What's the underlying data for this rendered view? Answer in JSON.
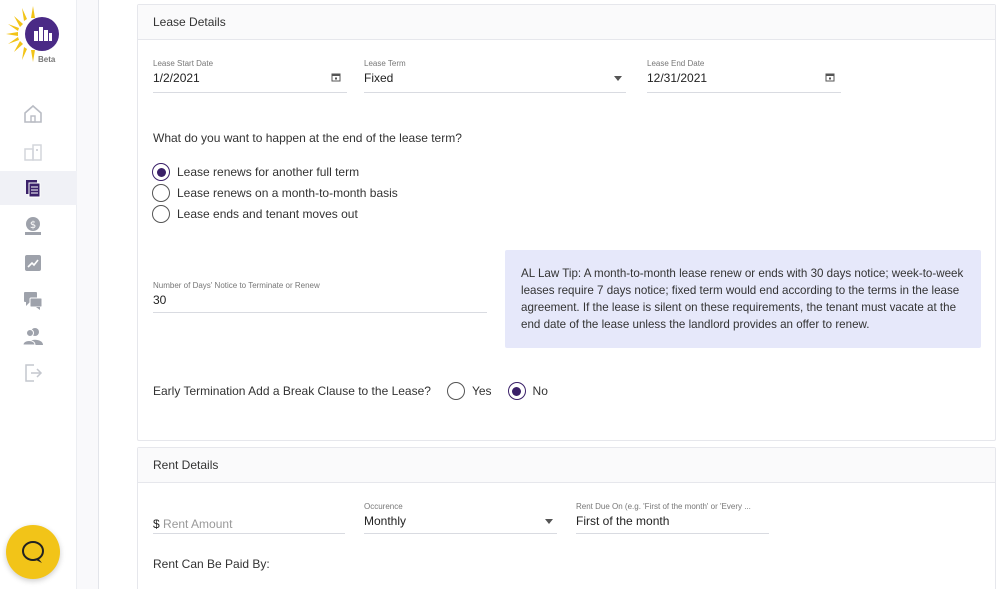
{
  "sidebar": {
    "beta_label": "Beta",
    "items": [
      {
        "icon": "home-icon"
      },
      {
        "icon": "properties-icon"
      },
      {
        "icon": "documents-icon",
        "active": true
      },
      {
        "icon": "payments-icon"
      },
      {
        "icon": "reports-icon"
      },
      {
        "icon": "messages-icon"
      },
      {
        "icon": "tenants-icon"
      },
      {
        "icon": "logout-icon"
      }
    ]
  },
  "lease": {
    "title": "Lease Details",
    "start_label": "Lease Start Date",
    "start_value": "1/2/2021",
    "term_label": "Lease Term",
    "term_value": "Fixed",
    "end_label": "Lease End Date",
    "end_value": "12/31/2021",
    "end_question": "What do you want to happen at the end of the lease term?",
    "options": [
      {
        "label": "Lease renews for another full term",
        "checked": true
      },
      {
        "label": "Lease renews on a month-to-month basis",
        "checked": false
      },
      {
        "label": "Lease ends and tenant moves out",
        "checked": false
      }
    ],
    "notice_label": "Number of Days' Notice to Terminate or Renew",
    "notice_value": "30",
    "tip": "AL Law Tip: A month-to-month lease renew or ends with 30 days notice; week-to-week leases require 7 days notice; fixed term would end according to the terms in the lease agreement. If the lease is silent on these requirements, the tenant must vacate at the end date of the lease unless the landlord provides an offer to renew.",
    "early_label": "Early Termination Add a Break Clause to the Lease?",
    "yes_label": "Yes",
    "no_label": "No",
    "early_selected": "No"
  },
  "rent": {
    "title": "Rent Details",
    "currency": "$",
    "amount_placeholder": "Rent Amount",
    "occurrence_label": "Occurence",
    "occurrence_value": "Monthly",
    "due_label": "Rent Due On (e.g. 'First of the month' or 'Every ...",
    "due_value": "First of the month",
    "paid_by_label": "Rent Can Be Paid By:"
  },
  "colors": {
    "accent": "#3a2069",
    "tip_bg": "#e6e8fa",
    "chat": "#f2c418"
  }
}
